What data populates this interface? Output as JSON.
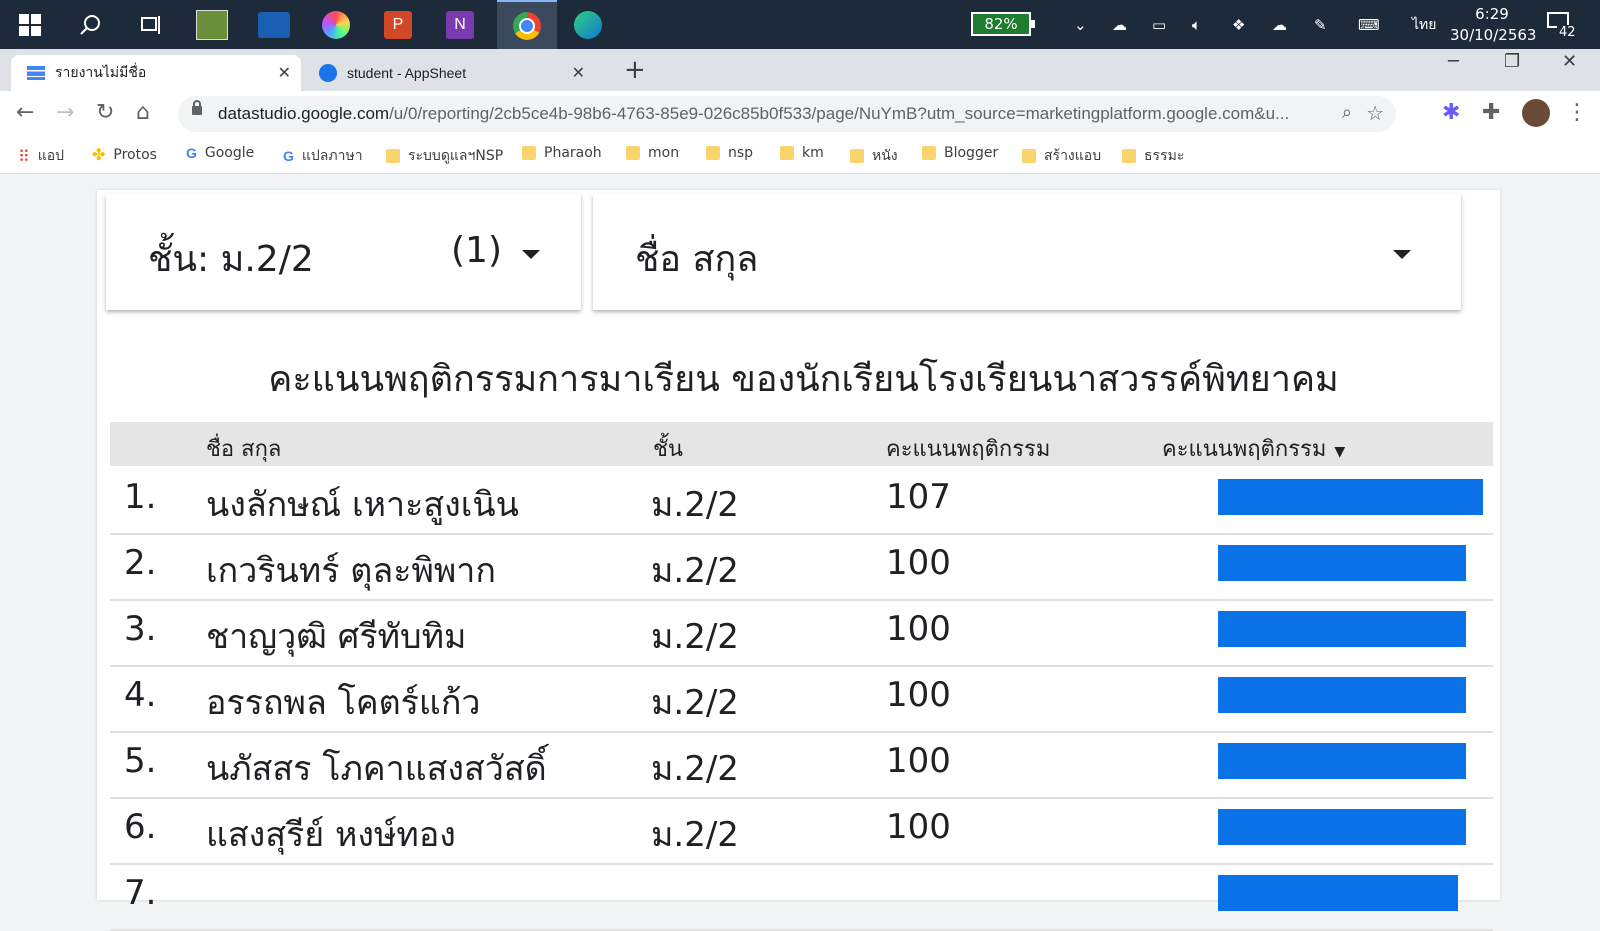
{
  "taskbar": {
    "apps": [
      "windows-start",
      "search",
      "task-view",
      "dbook-pro",
      "whiteboard",
      "paint",
      "powerpoint",
      "onenote",
      "chrome",
      "edge"
    ],
    "battery": "82%",
    "language": "ไทย",
    "time": "6:29",
    "date": "30/10/2563",
    "notifications": "42"
  },
  "tabs": [
    {
      "title": "รายงานไม่มีชื่อ",
      "active": true
    },
    {
      "title": "student - AppSheet",
      "active": false
    }
  ],
  "address": {
    "host": "datastudio.google.com",
    "path": "/u/0/reporting/2cb5ce4b-98b6-4763-85e9-026c85b0f533/page/NuYmB?utm_source=marketingplatform.google.com&u..."
  },
  "bookmarks": [
    "แอป",
    "Protos",
    "Google",
    "แปลภาษา",
    "ระบบดูแลฯNSP",
    "Pharaoh",
    "mon",
    "nsp",
    "km",
    "หนัง",
    "Blogger",
    "สร้างแอบ",
    "ธรรมะ"
  ],
  "filters": {
    "class_label": "ชั้น: ม.2/2",
    "class_count": "(1)",
    "name_label": "ชื่อ สกุล"
  },
  "report": {
    "title": "คะแนนพฤติกรรมการมาเรียน ของนักเรียนโรงเรียนนาสวรรค์พิทยาคม",
    "columns": [
      "ชื่อ สกุล",
      "ชั้น",
      "คะแนนพฤติกรรม",
      "คะแนนพฤติกรรม"
    ],
    "rows": [
      {
        "num": "1.",
        "name": "นงลักษณ์ เหาะสูงเนิน",
        "class": "ม.2/2",
        "score": "107",
        "bar": 107
      },
      {
        "num": "2.",
        "name": "เกวรินทร์ ตุละพิพาก",
        "class": "ม.2/2",
        "score": "100",
        "bar": 100
      },
      {
        "num": "3.",
        "name": "ชาญวุฒิ ศรีทับทิม",
        "class": "ม.2/2",
        "score": "100",
        "bar": 100
      },
      {
        "num": "4.",
        "name": "อรรถพล โคตร์แก้ว",
        "class": "ม.2/2",
        "score": "100",
        "bar": 100
      },
      {
        "num": "5.",
        "name": "นภัสสร โภคาแสงสวัสดิ์",
        "class": "ม.2/2",
        "score": "100",
        "bar": 100
      },
      {
        "num": "6.",
        "name": "แสงสุรีย์ หงษ์ทอง",
        "class": "ม.2/2",
        "score": "100",
        "bar": 100
      },
      {
        "num": "7.",
        "name": "",
        "class": "",
        "score": "",
        "bar": 97
      }
    ],
    "bar_color": "#0b72e7",
    "bar_max": 107
  }
}
